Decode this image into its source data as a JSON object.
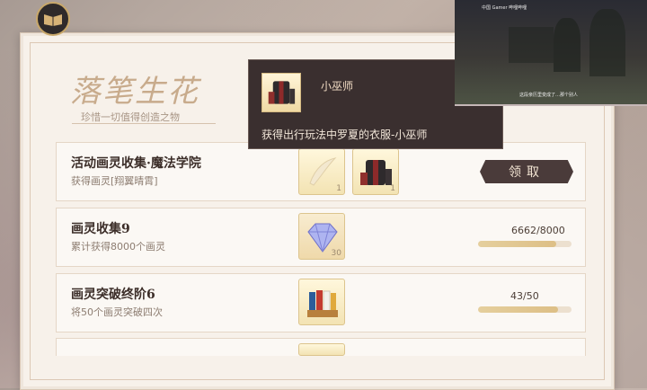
{
  "header": {
    "title": "落笔生花",
    "subtitle": "珍惜一切值得创造之物"
  },
  "tasks": [
    {
      "title": "活动画灵收集·魔法学院",
      "desc": "获得画灵[翔翼晴霄]",
      "rewards": [
        {
          "icon": "feather-card-icon",
          "qty": "1"
        },
        {
          "icon": "outfit-icon",
          "qty": "1"
        }
      ],
      "button": "领取"
    },
    {
      "title": "画灵收集9",
      "desc": "累计获得8000个画灵",
      "rewards": [
        {
          "icon": "diamond-icon",
          "qty": "30"
        }
      ],
      "progress_text": "6662/8000",
      "progress": 0.8328
    },
    {
      "title": "画灵突破终阶6",
      "desc": "将50个画灵突破四次",
      "rewards": [
        {
          "icon": "paint-tubes-icon",
          "qty": ""
        }
      ],
      "progress_text": "43/50",
      "progress": 0.86
    }
  ],
  "tooltip": {
    "name": "小巫师",
    "desc": "获得出行玩法中罗夏的衣服-小巫师"
  },
  "video_overlay": {
    "header": "中国 Gamer 哔哩哔哩",
    "caption": "这段亲历里变成了…那个别人"
  },
  "colors": {
    "accent_dark": "#4a3b3a",
    "progress_fill": "#ddbf86",
    "panel_bg": "#f7f1ea"
  }
}
